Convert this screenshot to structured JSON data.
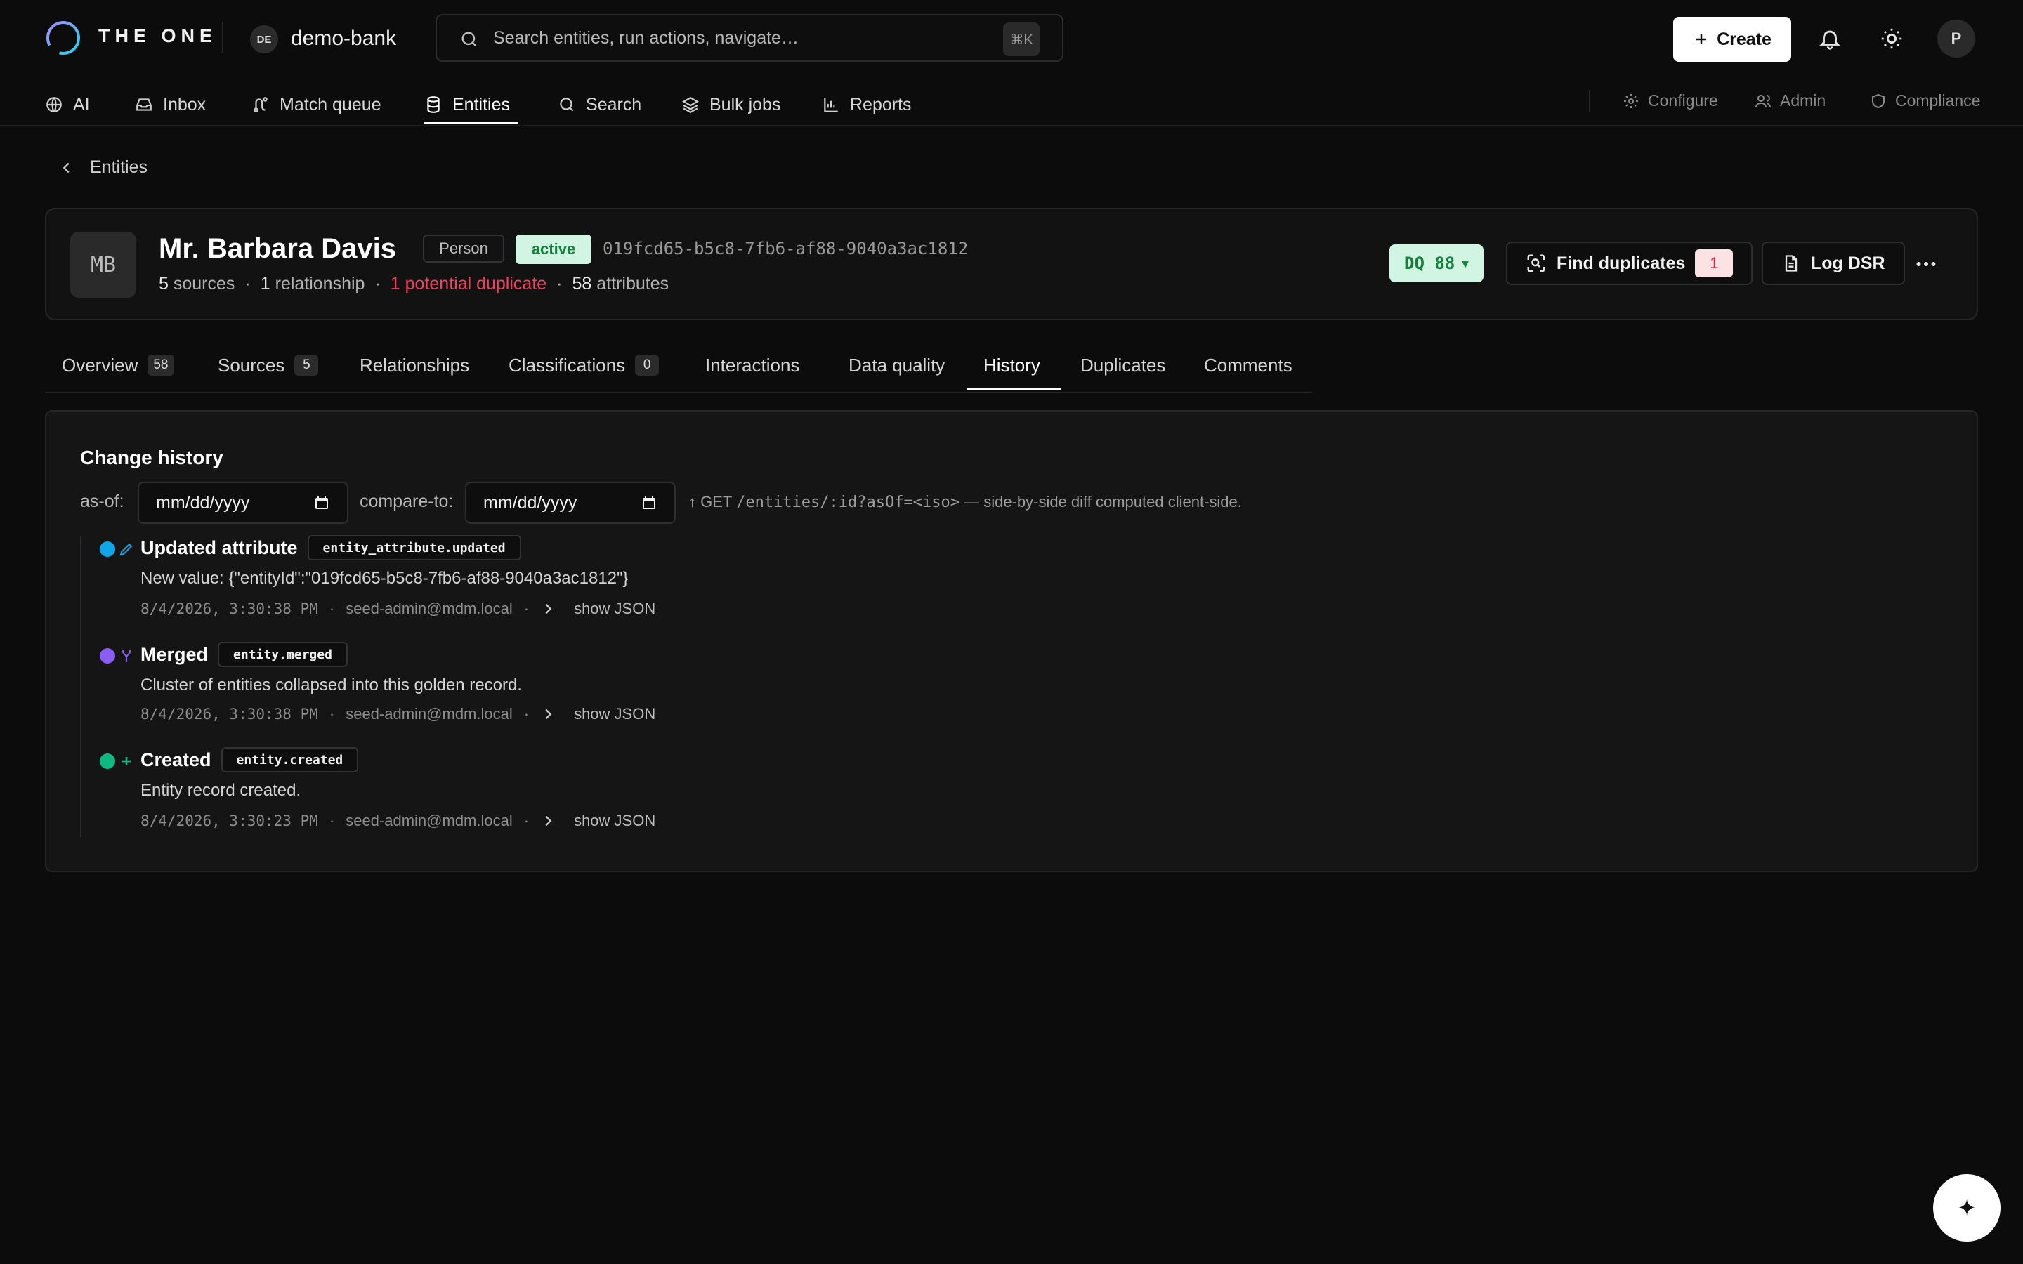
{
  "app": {
    "brand": "THE ONE",
    "workspace_initials": "DE",
    "workspace_name": "demo-bank"
  },
  "search": {
    "placeholder": "Search entities, run actions, navigate…",
    "shortcut": "⌘K"
  },
  "header": {
    "create_label": "Create",
    "avatar_initial": "P"
  },
  "nav": {
    "items": [
      {
        "label": "AI",
        "icon": "globe-icon"
      },
      {
        "label": "Inbox",
        "icon": "inbox-icon"
      },
      {
        "label": "Match queue",
        "icon": "route-icon"
      },
      {
        "label": "Entities",
        "icon": "database-icon",
        "active": true
      },
      {
        "label": "Search",
        "icon": "search-icon"
      },
      {
        "label": "Bulk jobs",
        "icon": "layers-icon"
      },
      {
        "label": "Reports",
        "icon": "bar-chart-icon"
      }
    ],
    "right": [
      {
        "label": "Configure",
        "icon": "gear-icon"
      },
      {
        "label": "Admin",
        "icon": "users-icon"
      },
      {
        "label": "Compliance",
        "icon": "shield-icon"
      }
    ]
  },
  "breadcrumb": {
    "back_label": "Entities"
  },
  "entity": {
    "initials": "MB",
    "name": "Mr. Barbara Davis",
    "type": "Person",
    "status": "active",
    "id": "019fcd65-b5c8-7fb6-af88-9040a3ac1812",
    "stats": {
      "sources_count": "5",
      "sources_label": "sources",
      "relationships_count": "1",
      "relationships_label": "relationship",
      "duplicates_text": "1 potential duplicate",
      "attributes_count": "58",
      "attributes_label": "attributes"
    },
    "dq_label": "DQ 88",
    "find_duplicates_label": "Find duplicates",
    "duplicates_count": "1",
    "log_dsr_label": "Log DSR"
  },
  "tabs": [
    {
      "label": "Overview",
      "count": "58"
    },
    {
      "label": "Sources",
      "count": "5"
    },
    {
      "label": "Relationships"
    },
    {
      "label": "Classifications",
      "count": "0"
    },
    {
      "label": "Interactions"
    },
    {
      "label": "Data quality"
    },
    {
      "label": "History",
      "active": true
    },
    {
      "label": "Duplicates"
    },
    {
      "label": "Comments"
    }
  ],
  "history": {
    "title": "Change history",
    "as_of_label": "as-of:",
    "as_of_value": "mm/dd/yyyy",
    "compare_label": "compare-to:",
    "compare_value": "mm/dd/yyyy",
    "hint_arrow": "↑ GET",
    "hint_path": "/entities/:id?asOf=<iso>",
    "hint_text": "— side-by-side diff computed client-side.",
    "events": [
      {
        "title": "Updated attribute",
        "tag": "entity_attribute.updated",
        "description": "New value: {\"entityId\":\"019fcd65-b5c8-7fb6-af88-9040a3ac1812\"}",
        "timestamp": "8/4/2026, 3:30:38 PM",
        "actor": "seed-admin@mdm.local",
        "show_json": "show JSON",
        "color": "#0ea5e9",
        "icon": "pencil-icon"
      },
      {
        "title": "Merged",
        "tag": "entity.merged",
        "description": "Cluster of entities collapsed into this golden record.",
        "timestamp": "8/4/2026, 3:30:38 PM",
        "actor": "seed-admin@mdm.local",
        "show_json": "show JSON",
        "color": "#8b5cf6",
        "icon": "merge-icon"
      },
      {
        "title": "Created",
        "tag": "entity.created",
        "description": "Entity record created.",
        "timestamp": "8/4/2026, 3:30:23 PM",
        "actor": "seed-admin@mdm.local",
        "show_json": "show JSON",
        "color": "#10b981",
        "icon": "plus-icon"
      }
    ]
  },
  "colors": {
    "accent_green_bg": "#d2f5e3",
    "accent_green_text": "#15803d",
    "danger": "#f43f5e"
  },
  "fab": {
    "icon": "sparkle-icon",
    "glyph": "✦"
  }
}
